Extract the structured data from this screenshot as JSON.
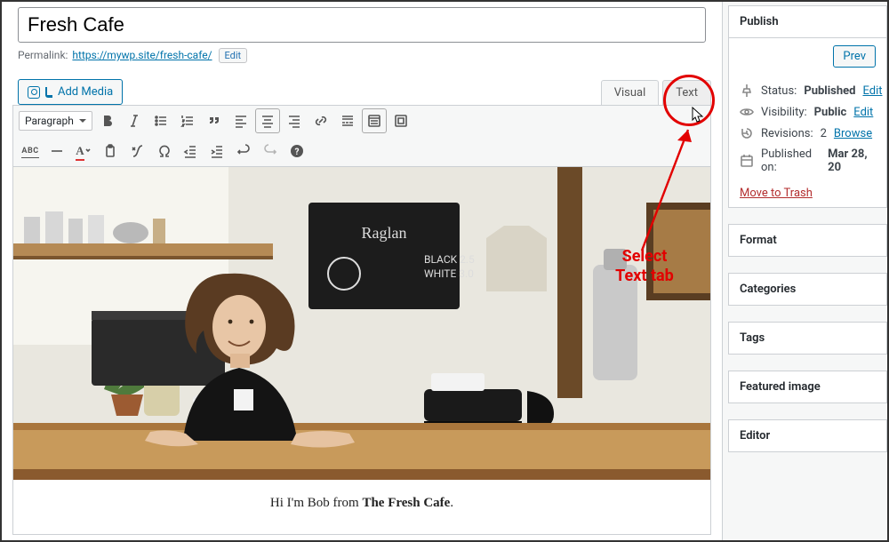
{
  "title": "Fresh Cafe",
  "permalink": {
    "label": "Permalink:",
    "url": "https://mywp.site/fresh-cafe/",
    "edit": "Edit"
  },
  "addMedia": "Add Media",
  "editorTabs": {
    "visual": "Visual",
    "text": "Text"
  },
  "format_select": "Paragraph",
  "article": {
    "line1_pre": "Hi I'm Bob from ",
    "line1_strong": "The Fresh Cafe",
    "line1_post": "."
  },
  "publish": {
    "panelTitle": "Publish",
    "preview": "Prev",
    "statusLabel": "Status:",
    "statusValue": "Published",
    "visibilityLabel": "Visibility:",
    "visibilityValue": "Public",
    "revisionsLabel": "Revisions:",
    "revisionsCount": "2",
    "browse": "Browse",
    "publishedOnLabel": "Published on:",
    "publishedOnValue": "Mar 28, 20",
    "edit": "Edit",
    "trash": "Move to Trash"
  },
  "panels": {
    "format": "Format",
    "categories": "Categories",
    "tags": "Tags",
    "featured": "Featured image",
    "editor": "Editor"
  },
  "annotation": {
    "line1": "Select",
    "line2": "Text tab"
  }
}
